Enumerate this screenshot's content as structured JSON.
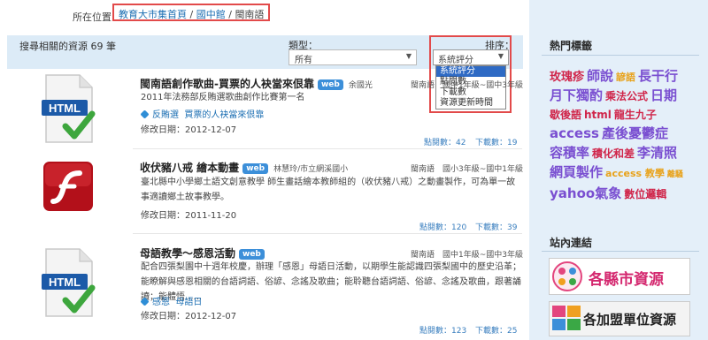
{
  "breadcrumb": {
    "label": "所在位置",
    "items": [
      "教育大市集首頁",
      "國中館",
      "閩南語"
    ],
    "separator": "/"
  },
  "filter": {
    "result_count": "搜尋相關的資源 69 筆",
    "type_label": "類型：",
    "type_value": "所有",
    "sort_label": "排序：",
    "sort_value": "系統評分",
    "sort_options": [
      "系統評分",
      "點閱數",
      "下載數",
      "資源更新時間"
    ]
  },
  "results": [
    {
      "title": "閩南語創作歌曲-買票的人袂當來佷靠",
      "badge": "web",
      "author": "余國光",
      "meta": "閩南語　國中1年級~國中3年級",
      "desc": "2011年法務部反賄選歌曲創作比賽第一名",
      "tags": [
        "反賄選",
        "買票的人袂當來佷靠"
      ],
      "modified": "修改日期：2012-12-07",
      "views": "點閱數：42",
      "downloads": "下載數：19"
    },
    {
      "title": "收伏豬八戒 繪本動畫",
      "badge": "web",
      "author": "林慧玲/市立網溪國小",
      "meta": "閩南語　國小3年級~國中1年級",
      "desc": "臺北縣中小學鄉土語文創意教學 師生畫話繪本教師組的（收伏豬八戒）之動畫製作，可為單一故事適讀鄉土故事教學。",
      "tags": [],
      "modified": "修改日期：2011-11-20",
      "views": "點閱數：120",
      "downloads": "下載數：39"
    },
    {
      "title": "母語教學～感恩活動",
      "badge": "web",
      "author": "",
      "meta": "閩南語　國中1年級~國中3年級",
      "desc": "配合四張梨園中十週年校慶，辦理「感恩」母語日活動，以期學生能認識四張梨國中的歷史沿革；能瞭解與感恩相關的台語詞語、俗諺、念謠及歌曲；能聆聽台語詞語、俗諺、念謠及歌曲，跟著誦讀；能體悟......",
      "tags": [
        "感恩",
        "母語日"
      ],
      "modified": "修改日期：2012-12-07",
      "views": "點閱數：123",
      "downloads": "下載數：25"
    }
  ],
  "sidebar": {
    "hot_tags_title": "熱門標籤",
    "tags": [
      {
        "text": "玫瑰疹",
        "color": "#d0254a",
        "size": 13
      },
      {
        "text": "師說",
        "color": "#7a4fd1",
        "size": 15
      },
      {
        "text": "諺語",
        "color": "#e8a21a",
        "size": 11
      },
      {
        "text": "長干行",
        "color": "#7a4fd1",
        "size": 15
      },
      {
        "text": "月下獨酌",
        "color": "#7a4fd1",
        "size": 15
      },
      {
        "text": "乘法公式",
        "color": "#d0254a",
        "size": 12
      },
      {
        "text": "日期",
        "color": "#7a4fd1",
        "size": 15
      },
      {
        "text": "歇後語",
        "color": "#d0254a",
        "size": 12
      },
      {
        "text": "html",
        "color": "#d0254a",
        "size": 12
      },
      {
        "text": "龍生九子",
        "color": "#d0254a",
        "size": 12
      },
      {
        "text": "access",
        "color": "#7a4fd1",
        "size": 15
      },
      {
        "text": "產後憂鬱症",
        "color": "#7a4fd1",
        "size": 15
      },
      {
        "text": "容積率",
        "color": "#7a4fd1",
        "size": 15
      },
      {
        "text": "積化和差",
        "color": "#d0254a",
        "size": 12
      },
      {
        "text": "李清照",
        "color": "#7a4fd1",
        "size": 15
      },
      {
        "text": "網頁製作",
        "color": "#7a4fd1",
        "size": 15
      },
      {
        "text": "access 教學",
        "color": "#e8a21a",
        "size": 11
      },
      {
        "text": "離騷",
        "color": "#e8a21a",
        "size": 9
      },
      {
        "text": "yahoo氣象",
        "color": "#7a4fd1",
        "size": 15
      },
      {
        "text": "數位邏輯",
        "color": "#d0254a",
        "size": 12
      }
    ],
    "links_title": "站內連結",
    "banners": [
      "各縣市資源",
      "各加盟單位資源"
    ]
  }
}
